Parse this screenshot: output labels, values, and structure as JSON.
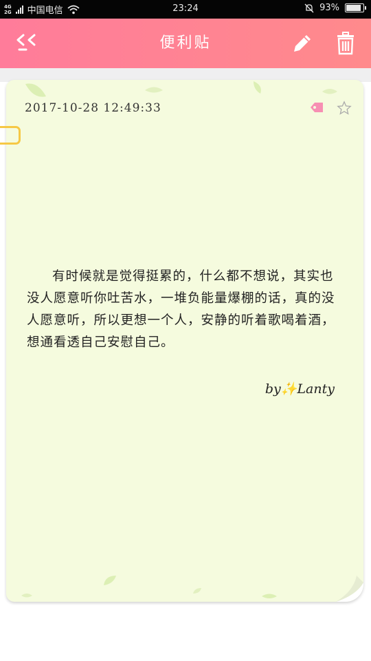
{
  "status_bar": {
    "network_top": "4G",
    "network_bottom": "2G",
    "carrier": "中国电信",
    "time": "23:24",
    "battery": "93%"
  },
  "header": {
    "title": "便利贴",
    "back_icon": "back-chevron-icon",
    "edit_icon": "pencil-icon",
    "delete_icon": "trash-icon",
    "color": "#ff7f96"
  },
  "note": {
    "datetime": "2017-10-28 12:49:33",
    "tag_icon": "tag-icon",
    "star_icon": "star-outline-icon",
    "content": "有时候就是觉得挺累的，什么都不想说，其实也没人愿意听你吐苦水，一堆负能量爆棚的话，真的没人愿意听，所以更想一个人，安静的听着歌喝着酒，想通看透自己安慰自己。",
    "signature": "by✨Lanty",
    "background": "#f5fbde"
  }
}
